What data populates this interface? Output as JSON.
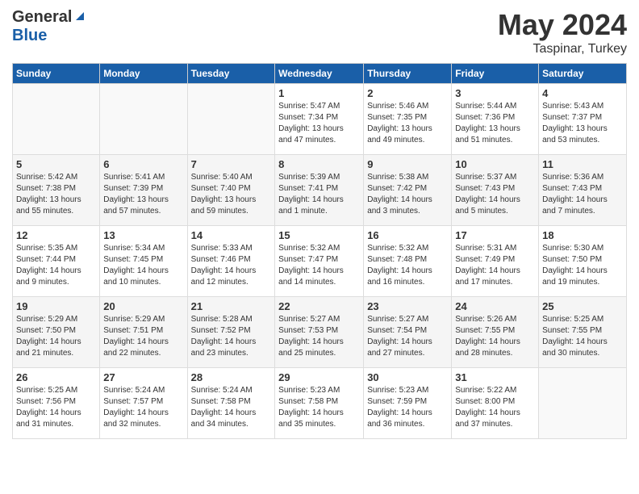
{
  "header": {
    "logo_general": "General",
    "logo_blue": "Blue",
    "title": "May 2024",
    "location": "Taspinar, Turkey"
  },
  "days_of_week": [
    "Sunday",
    "Monday",
    "Tuesday",
    "Wednesday",
    "Thursday",
    "Friday",
    "Saturday"
  ],
  "weeks": [
    [
      {
        "day": "",
        "info": ""
      },
      {
        "day": "",
        "info": ""
      },
      {
        "day": "",
        "info": ""
      },
      {
        "day": "1",
        "info": "Sunrise: 5:47 AM\nSunset: 7:34 PM\nDaylight: 13 hours\nand 47 minutes."
      },
      {
        "day": "2",
        "info": "Sunrise: 5:46 AM\nSunset: 7:35 PM\nDaylight: 13 hours\nand 49 minutes."
      },
      {
        "day": "3",
        "info": "Sunrise: 5:44 AM\nSunset: 7:36 PM\nDaylight: 13 hours\nand 51 minutes."
      },
      {
        "day": "4",
        "info": "Sunrise: 5:43 AM\nSunset: 7:37 PM\nDaylight: 13 hours\nand 53 minutes."
      }
    ],
    [
      {
        "day": "5",
        "info": "Sunrise: 5:42 AM\nSunset: 7:38 PM\nDaylight: 13 hours\nand 55 minutes."
      },
      {
        "day": "6",
        "info": "Sunrise: 5:41 AM\nSunset: 7:39 PM\nDaylight: 13 hours\nand 57 minutes."
      },
      {
        "day": "7",
        "info": "Sunrise: 5:40 AM\nSunset: 7:40 PM\nDaylight: 13 hours\nand 59 minutes."
      },
      {
        "day": "8",
        "info": "Sunrise: 5:39 AM\nSunset: 7:41 PM\nDaylight: 14 hours\nand 1 minute."
      },
      {
        "day": "9",
        "info": "Sunrise: 5:38 AM\nSunset: 7:42 PM\nDaylight: 14 hours\nand 3 minutes."
      },
      {
        "day": "10",
        "info": "Sunrise: 5:37 AM\nSunset: 7:43 PM\nDaylight: 14 hours\nand 5 minutes."
      },
      {
        "day": "11",
        "info": "Sunrise: 5:36 AM\nSunset: 7:43 PM\nDaylight: 14 hours\nand 7 minutes."
      }
    ],
    [
      {
        "day": "12",
        "info": "Sunrise: 5:35 AM\nSunset: 7:44 PM\nDaylight: 14 hours\nand 9 minutes."
      },
      {
        "day": "13",
        "info": "Sunrise: 5:34 AM\nSunset: 7:45 PM\nDaylight: 14 hours\nand 10 minutes."
      },
      {
        "day": "14",
        "info": "Sunrise: 5:33 AM\nSunset: 7:46 PM\nDaylight: 14 hours\nand 12 minutes."
      },
      {
        "day": "15",
        "info": "Sunrise: 5:32 AM\nSunset: 7:47 PM\nDaylight: 14 hours\nand 14 minutes."
      },
      {
        "day": "16",
        "info": "Sunrise: 5:32 AM\nSunset: 7:48 PM\nDaylight: 14 hours\nand 16 minutes."
      },
      {
        "day": "17",
        "info": "Sunrise: 5:31 AM\nSunset: 7:49 PM\nDaylight: 14 hours\nand 17 minutes."
      },
      {
        "day": "18",
        "info": "Sunrise: 5:30 AM\nSunset: 7:50 PM\nDaylight: 14 hours\nand 19 minutes."
      }
    ],
    [
      {
        "day": "19",
        "info": "Sunrise: 5:29 AM\nSunset: 7:50 PM\nDaylight: 14 hours\nand 21 minutes."
      },
      {
        "day": "20",
        "info": "Sunrise: 5:29 AM\nSunset: 7:51 PM\nDaylight: 14 hours\nand 22 minutes."
      },
      {
        "day": "21",
        "info": "Sunrise: 5:28 AM\nSunset: 7:52 PM\nDaylight: 14 hours\nand 23 minutes."
      },
      {
        "day": "22",
        "info": "Sunrise: 5:27 AM\nSunset: 7:53 PM\nDaylight: 14 hours\nand 25 minutes."
      },
      {
        "day": "23",
        "info": "Sunrise: 5:27 AM\nSunset: 7:54 PM\nDaylight: 14 hours\nand 27 minutes."
      },
      {
        "day": "24",
        "info": "Sunrise: 5:26 AM\nSunset: 7:55 PM\nDaylight: 14 hours\nand 28 minutes."
      },
      {
        "day": "25",
        "info": "Sunrise: 5:25 AM\nSunset: 7:55 PM\nDaylight: 14 hours\nand 30 minutes."
      }
    ],
    [
      {
        "day": "26",
        "info": "Sunrise: 5:25 AM\nSunset: 7:56 PM\nDaylight: 14 hours\nand 31 minutes."
      },
      {
        "day": "27",
        "info": "Sunrise: 5:24 AM\nSunset: 7:57 PM\nDaylight: 14 hours\nand 32 minutes."
      },
      {
        "day": "28",
        "info": "Sunrise: 5:24 AM\nSunset: 7:58 PM\nDaylight: 14 hours\nand 34 minutes."
      },
      {
        "day": "29",
        "info": "Sunrise: 5:23 AM\nSunset: 7:58 PM\nDaylight: 14 hours\nand 35 minutes."
      },
      {
        "day": "30",
        "info": "Sunrise: 5:23 AM\nSunset: 7:59 PM\nDaylight: 14 hours\nand 36 minutes."
      },
      {
        "day": "31",
        "info": "Sunrise: 5:22 AM\nSunset: 8:00 PM\nDaylight: 14 hours\nand 37 minutes."
      },
      {
        "day": "",
        "info": ""
      }
    ]
  ]
}
